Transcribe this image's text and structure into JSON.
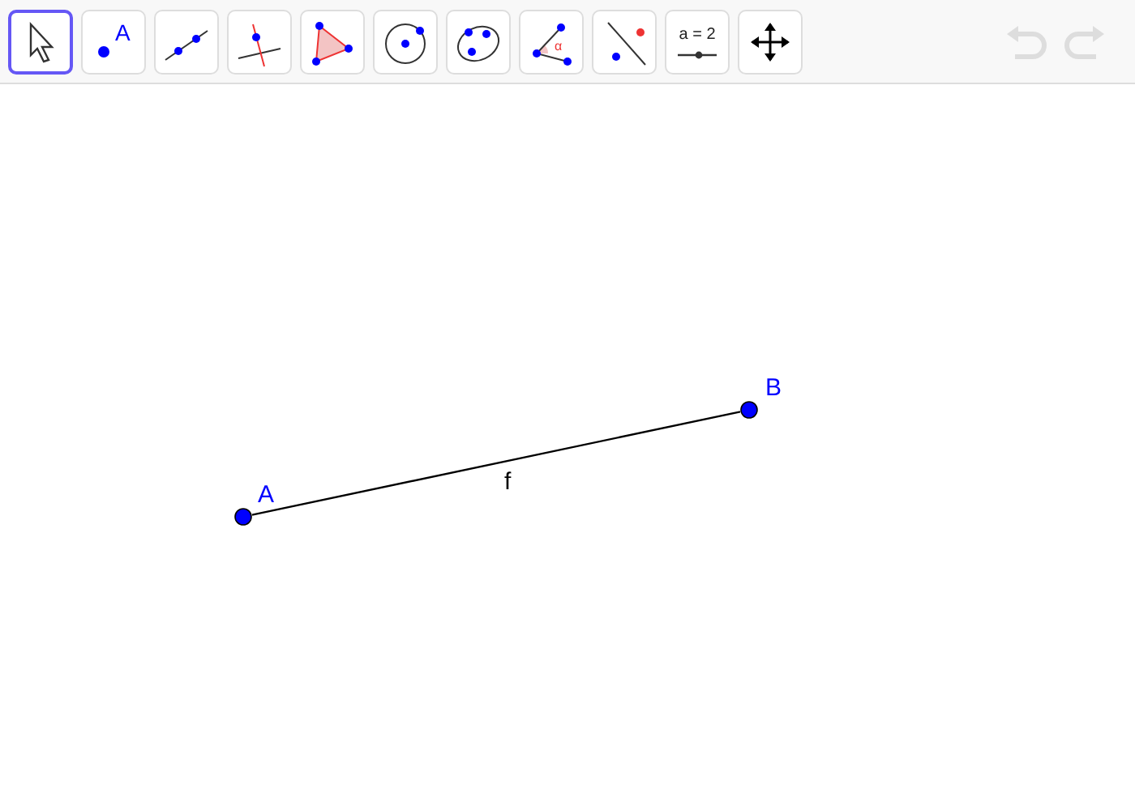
{
  "toolbar": {
    "tools": [
      {
        "kind": "move",
        "selected": true
      },
      {
        "kind": "point",
        "selected": false,
        "text": "A"
      },
      {
        "kind": "line",
        "selected": false
      },
      {
        "kind": "perpendicular",
        "selected": false
      },
      {
        "kind": "polygon",
        "selected": false
      },
      {
        "kind": "circle",
        "selected": false
      },
      {
        "kind": "conic",
        "selected": false
      },
      {
        "kind": "angle",
        "selected": false,
        "text": "α"
      },
      {
        "kind": "reflect",
        "selected": false
      },
      {
        "kind": "slider",
        "selected": false,
        "text": "a = 2"
      },
      {
        "kind": "move-view",
        "selected": false
      }
    ],
    "undo": {
      "disabled": true
    },
    "redo": {
      "disabled": true
    }
  },
  "canvas": {
    "points": [
      {
        "label": "A"
      },
      {
        "label": "B"
      }
    ],
    "segments": [
      {
        "label": "f"
      }
    ]
  }
}
